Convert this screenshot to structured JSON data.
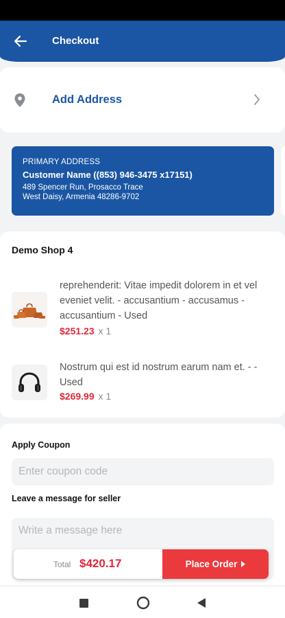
{
  "header": {
    "title": "Checkout"
  },
  "address": {
    "add_label": "Add Address",
    "primary": {
      "label": "PRIMARY ADDRESS",
      "name": "Customer Name ((853) 946-3475 x17151)",
      "line1": "489 Spencer Run, Prosacco Trace",
      "line2": "West Daisy, Armenia 48286-9702"
    }
  },
  "shop": {
    "name": "Demo Shop 4",
    "items": [
      {
        "description": "reprehenderit: Vitae impedit dolorem in et vel eveniet velit. - accusantium - accusamus - accusantium - Used",
        "price": "$251.23",
        "qty": "x 1",
        "icon": "handbag-set-image"
      },
      {
        "description": "Nostrum qui est id nostrum earum nam et. - - Used",
        "price": "$269.99",
        "qty": "x 1",
        "icon": "headphones-image"
      }
    ]
  },
  "coupon": {
    "label": "Apply Coupon",
    "placeholder": "Enter coupon code"
  },
  "message": {
    "label": "Leave a message for seller",
    "placeholder": "Write a message here"
  },
  "footer": {
    "total_label": "Total",
    "total_value": "$420.17",
    "place_order_label": "Place Order"
  },
  "colors": {
    "primary": "#1a56a3",
    "accent": "#ea3a3e",
    "price": "#e0283a"
  }
}
